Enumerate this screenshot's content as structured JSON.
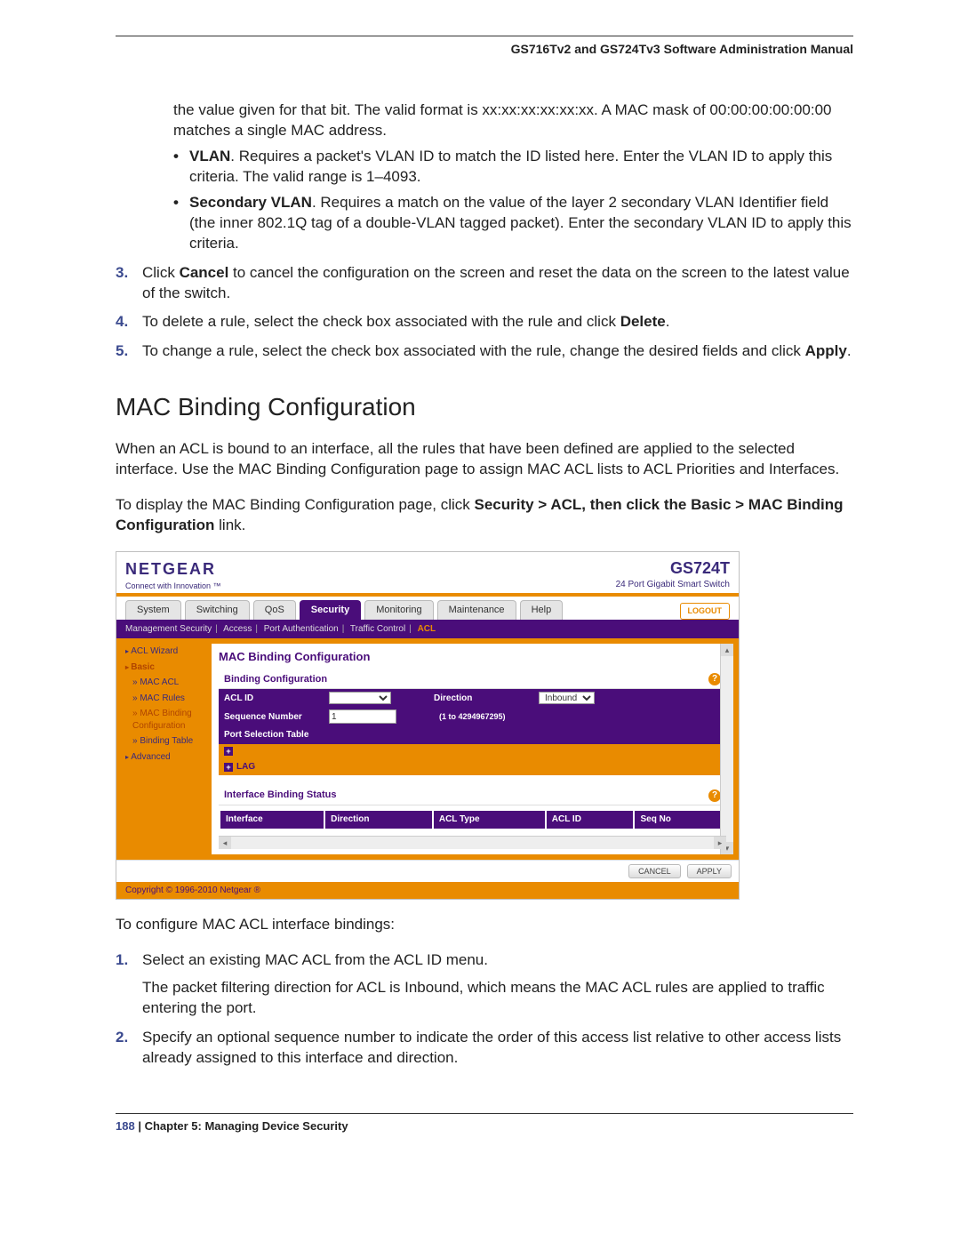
{
  "header": {
    "manual_title": "GS716Tv2 and GS724Tv3 Software Administration Manual"
  },
  "continuation": {
    "mac_mask_tail": "the value given for that bit. The valid format is xx:xx:xx:xx:xx:xx. A MAC mask of 00:00:00:00:00:00 matches a single MAC address.",
    "vlan_label": "VLAN",
    "vlan_text": ". Requires a packet's VLAN ID to match the ID listed here. Enter the VLAN ID to apply this criteria. The valid range is 1–4093.",
    "svlan_label": "Secondary VLAN",
    "svlan_text": ". Requires a match on the value of the layer 2 secondary VLAN Identifier field (the inner 802.1Q tag of a double-VLAN tagged packet). Enter the secondary VLAN ID to apply this criteria."
  },
  "steps_a": {
    "s3_num": "3.",
    "s3_pre": "Click ",
    "s3_b": "Cancel",
    "s3_post": " to cancel the configuration on the screen and reset the data on the screen to the latest value of the switch.",
    "s4_num": "4.",
    "s4_pre": "To delete a rule, select the check box associated with the rule and click ",
    "s4_b": "Delete",
    "s4_post": ".",
    "s5_num": "5.",
    "s5_pre": "To change a rule, select the check box associated with the rule, change the desired fields and click ",
    "s5_b": "Apply",
    "s5_post": "."
  },
  "section": {
    "heading": "MAC Binding Configuration",
    "intro": "When an ACL is bound to an interface, all the rules that have been defined are applied to the selected interface. Use the MAC Binding Configuration page to assign MAC ACL lists to ACL Priorities and Interfaces.",
    "nav_pre": "To display the MAC Binding Configuration page, click ",
    "nav_bold": "Security > ACL, then click the Basic > MAC Binding Configuration",
    "nav_post": " link."
  },
  "ui": {
    "brand": "NETGEAR",
    "tagline": "Connect with Innovation ™",
    "model": "GS724T",
    "model_sub": "24 Port Gigabit Smart Switch",
    "tabs": [
      "System",
      "Switching",
      "QoS",
      "Security",
      "Monitoring",
      "Maintenance",
      "Help"
    ],
    "active_tab": "Security",
    "logout": "LOGOUT",
    "subnav": [
      "Management Security",
      "Access",
      "Port Authentication",
      "Traffic Control",
      "ACL"
    ],
    "subnav_active": "ACL",
    "side": {
      "acl_wizard": "ACL Wizard",
      "basic": "Basic",
      "mac_acl": "» MAC ACL",
      "mac_rules": "» MAC Rules",
      "mac_binding": "» MAC Binding Configuration",
      "binding_table": "» Binding Table",
      "advanced": "Advanced"
    },
    "panel_title": "MAC Binding Configuration",
    "binding_cfg": "Binding Configuration",
    "acl_id_lbl": "ACL ID",
    "direction_lbl": "Direction",
    "direction_val": "Inbound",
    "seq_lbl": "Sequence Number",
    "seq_val": "1",
    "seq_range": "(1 to 4294967295)",
    "port_sel": "Port Selection Table",
    "lag": "LAG",
    "ibs_title": "Interface Binding Status",
    "ibs_cols": [
      "Interface",
      "Direction",
      "ACL Type",
      "ACL ID",
      "Seq No"
    ],
    "cancel": "CANCEL",
    "apply": "APPLY",
    "copyright": "Copyright © 1996-2010 Netgear ®"
  },
  "after": {
    "intro": "To configure MAC ACL interface bindings:",
    "s1_num": "1.",
    "s1": "Select an existing MAC ACL from the ACL ID menu.",
    "s1_sub": "The packet filtering direction for ACL is Inbound, which means the MAC ACL rules are applied to traffic entering the port.",
    "s2_num": "2.",
    "s2": "Specify an optional sequence number to indicate the order of this access list relative to other access lists already assigned to this interface and direction."
  },
  "footer": {
    "page_num": "188",
    "sep": "   |   ",
    "chapter": "Chapter 5:  Managing Device Security"
  }
}
